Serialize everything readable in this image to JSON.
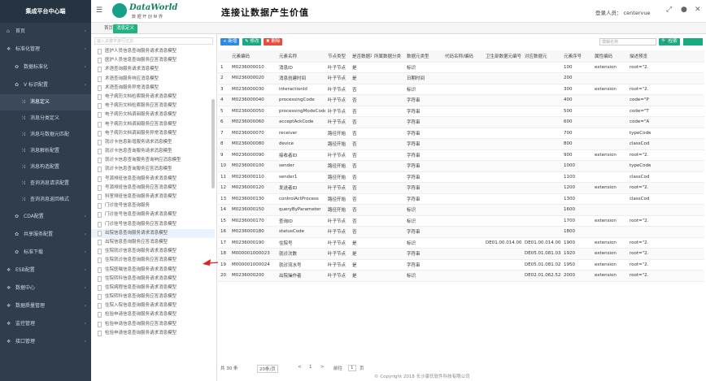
{
  "sidebar": {
    "title": "集成平台中心端",
    "items": [
      {
        "label": "首页",
        "level": 0,
        "icon": "home-icon"
      },
      {
        "label": "标准化管理",
        "level": 0,
        "icon": "cube-icon"
      },
      {
        "label": "数据标准化",
        "level": 1,
        "icon": "gear-icon"
      },
      {
        "label": "V 标识配置",
        "level": 1,
        "icon": "gear-icon"
      },
      {
        "label": "消息定义",
        "level": 2,
        "icon": "arrows-icon",
        "active": true
      },
      {
        "label": "消息分类定义",
        "level": 2,
        "icon": "arrows-icon"
      },
      {
        "label": "消息与数据元匹配",
        "level": 2,
        "icon": "arrows-icon"
      },
      {
        "label": "消息解析配置",
        "level": 2,
        "icon": "arrows-icon"
      },
      {
        "label": "消息构造配置",
        "level": 2,
        "icon": "arrows-icon"
      },
      {
        "label": "查询消息请求配置",
        "level": 2,
        "icon": "arrows-icon"
      },
      {
        "label": "查询消息返回格式",
        "level": 2,
        "icon": "arrows-icon"
      },
      {
        "label": "CDA配置",
        "level": 1,
        "icon": "gear-icon"
      },
      {
        "label": "共享服务配置",
        "level": 1,
        "icon": "gear-icon"
      },
      {
        "label": "标准下载",
        "level": 1,
        "icon": "gear-icon"
      },
      {
        "label": "ESB配置",
        "level": 0,
        "icon": "cube-icon"
      },
      {
        "label": "数据中心",
        "level": 0,
        "icon": "cube-icon"
      },
      {
        "label": "数据质量管理",
        "level": 0,
        "icon": "cube-icon"
      },
      {
        "label": "监控管理",
        "level": 0,
        "icon": "cube-icon"
      },
      {
        "label": "接口管理",
        "level": 0,
        "icon": "cube-icon"
      }
    ]
  },
  "header": {
    "logo_title": "DataWorld",
    "logo_subtitle": "数 据 开 创 世 界",
    "slogan": "连接让数据产生价值",
    "login_label": "登录人员：",
    "login_user": "centervue"
  },
  "tabs": {
    "home": "首页",
    "active": "消息定义"
  },
  "tree": {
    "search_placeholder": "输入关键字进行过滤",
    "items": [
      "医护人员信息查询服务请求消息模型",
      "医护人员信息查询服务应答消息模型",
      "术语查询服务请求消息模型",
      "术语查询服务响应消息模型",
      "术语查询服务异常消息模型",
      "电子病历文档检索服务请求消息模型",
      "电子病历文档检索服务应答消息模型",
      "电子病历文档调阅服务请求消息模型",
      "电子病历文档调阅服务应答消息模型",
      "电子病历文档调阅服务异常消息模型",
      "就诊卡信息新增服务请求消息模型",
      "就诊卡信息查询服务请求消息模型",
      "就诊卡信息查询服务查询响应消息模型",
      "就诊卡信息查询服务应答消息模型",
      "号源排班信息查询服务请求消息模型",
      "号源排班信息查询服务应答消息模型",
      "科室排班信息查询服务请求消息模型",
      "门诊挂号信息查询服务",
      "门诊挂号信息查询服务请求消息模型",
      "门诊挂号信息查询服务应答消息模型",
      "出院信息查询服务请求消息模型",
      "出院信息查询服务应答消息模型",
      "住院就诊信息查询服务请求消息模型",
      "住院就诊信息查询服务应答消息模型",
      "住院医嘱信息查询服务请求消息模型",
      "住院转科信息查询服务请求消息模型",
      "住院病程信息查询服务请求消息模型",
      "住院转科信息查询服务应答消息模型",
      "住院入院信息查询服务请求消息模型",
      "检验申请信息查询服务请求消息模型",
      "检验申请信息查询服务应答消息模型",
      "检验申请信息查询服务请求消息模型"
    ],
    "highlighted_index": 20
  },
  "toolbar": {
    "add": "+ 新增",
    "edit": "✎ 修改",
    "del": "✖ 删除",
    "search_placeholder": "模糊名称",
    "search": "🔍 检索"
  },
  "table": {
    "headers": [
      "",
      "元素编码",
      "元素名称",
      "节点类型",
      "是否数据项",
      "所属数据分类",
      "数据元类型",
      "代码名称/编码",
      "卫生部数据元编号",
      "对应数据元",
      "元素序号",
      "属性编码",
      "描述预览"
    ],
    "rows": [
      [
        "1",
        "M0236000010",
        "消息ID",
        "叶子节点",
        "是",
        "",
        "标识",
        "",
        "",
        "",
        "100",
        "extension",
        "root=\"2."
      ],
      [
        "2",
        "M0236000020",
        "消息创建时间",
        "叶子节点",
        "是",
        "",
        "日期时间",
        "",
        "",
        "",
        "200",
        "",
        ""
      ],
      [
        "3",
        "M0236000030",
        "interactionId",
        "叶子节点",
        "否",
        "",
        "标识",
        "",
        "",
        "",
        "300",
        "extension",
        "root=\"2."
      ],
      [
        "4",
        "M0236000040",
        "processingCode",
        "叶子节点",
        "否",
        "",
        "字符串",
        "",
        "",
        "",
        "400",
        "",
        "code=\"P"
      ],
      [
        "5",
        "M0236000050",
        "processingModeCode",
        "叶子节点",
        "否",
        "",
        "字符串",
        "",
        "",
        "",
        "500",
        "",
        "code=\"T"
      ],
      [
        "6",
        "M0236000060",
        "acceptAckCode",
        "叶子节点",
        "否",
        "",
        "字符串",
        "",
        "",
        "",
        "600",
        "",
        "code=\"A"
      ],
      [
        "7",
        "M0236000070",
        "receiver",
        "路径开始",
        "否",
        "",
        "字符串",
        "",
        "",
        "",
        "700",
        "",
        "typeCode"
      ],
      [
        "8",
        "M0236000080",
        "device",
        "路径开始",
        "否",
        "",
        "字符串",
        "",
        "",
        "",
        "800",
        "",
        "classCod"
      ],
      [
        "9",
        "M0236000090",
        "接收者ID",
        "叶子节点",
        "否",
        "",
        "字符串",
        "",
        "",
        "",
        "900",
        "extension",
        "root=\"2."
      ],
      [
        "10",
        "M0236000100",
        "sender",
        "路径开始",
        "否",
        "",
        "字符串",
        "",
        "",
        "",
        "1000",
        "",
        "typeCode"
      ],
      [
        "11",
        "M0236000110",
        "sender1",
        "路径开始",
        "否",
        "",
        "字符串",
        "",
        "",
        "",
        "1100",
        "",
        "classCod"
      ],
      [
        "12",
        "M0236000120",
        "发送者ID",
        "叶子节点",
        "否",
        "",
        "字符串",
        "",
        "",
        "",
        "1200",
        "extension",
        "root=\"2."
      ],
      [
        "13",
        "M0236000130",
        "controlActProcess",
        "路径开始",
        "否",
        "",
        "字符串",
        "",
        "",
        "",
        "1300",
        "",
        "classCod"
      ],
      [
        "14",
        "M0236000150",
        "queryByParameter",
        "路径开始",
        "否",
        "",
        "标识",
        "",
        "",
        "",
        "1600",
        "",
        ""
      ],
      [
        "15",
        "M0236000170",
        "查询ID",
        "叶子节点",
        "否",
        "",
        "标识",
        "",
        "",
        "",
        "1700",
        "extension",
        "root=\"2."
      ],
      [
        "16",
        "M0236000180",
        "statusCode",
        "叶子节点",
        "否",
        "",
        "字符串",
        "",
        "",
        "",
        "1800",
        "",
        ""
      ],
      [
        "17",
        "M0236000190",
        "住院号",
        "叶子节点",
        "是",
        "",
        "标识",
        "",
        "DE01.00.014.00",
        "DE01.00.014.00",
        "1900",
        "extension",
        "root=\"2."
      ],
      [
        "18",
        "M000001000023",
        "就诊次数",
        "叶子节点",
        "是",
        "",
        "字符串",
        "",
        "",
        "DE05.01.081.03",
        "1920",
        "extension",
        "root=\"2."
      ],
      [
        "19",
        "M000001000024",
        "就诊流水号",
        "叶子节点",
        "是",
        "",
        "字符串",
        "",
        "",
        "DE05.01.081.02",
        "1950",
        "extension",
        "root=\"2."
      ],
      [
        "20",
        "M0236000200",
        "出院操作者",
        "叶子节点",
        "是",
        "",
        "标识",
        "",
        "",
        "DE02.01.062.52",
        "2000",
        "extension",
        "root=\"2."
      ]
    ]
  },
  "pager": {
    "total": "共 30 条",
    "per_page": "20条/页",
    "prev": "<",
    "page": "1",
    "next": ">",
    "goto": "前往",
    "goto_page": "1",
    "page_unit": "页"
  },
  "footer": {
    "copyright": "© Copyright 2018 长沙康氏软件科技有限公司"
  }
}
